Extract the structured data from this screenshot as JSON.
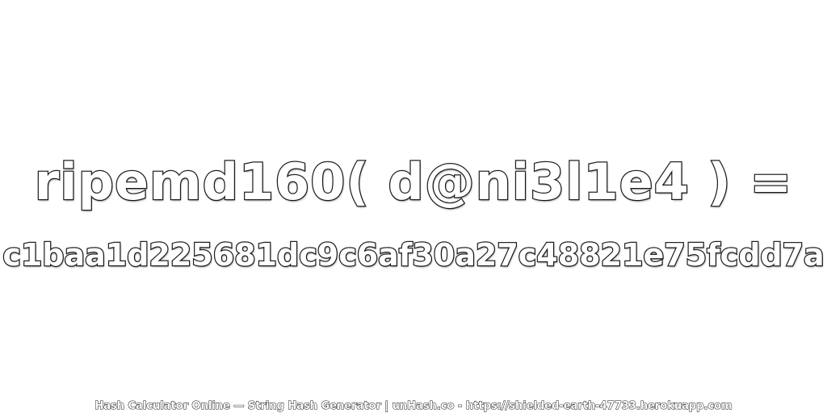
{
  "expression": "ripemd160( d@ni3l1e4 ) =",
  "hash_value": "c1baa1d225681dc9c6af30a27c48821e75fcdd7a",
  "footer_text": "Hash Calculator Online — String Hash Generator | unHash.co - https://shielded-earth-47733.herokuapp.com",
  "colors": {
    "text_fill": "#ffffff",
    "text_outline": "#222222",
    "background": "#ffffff"
  }
}
